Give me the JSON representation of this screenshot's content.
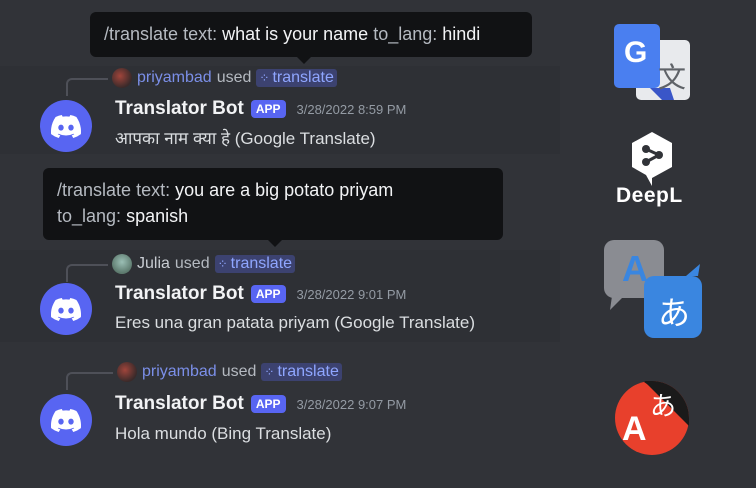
{
  "messages": [
    {
      "invoker": "priyambad",
      "used": "used",
      "command": "translate",
      "bot_name": "Translator Bot",
      "badge": "APP",
      "timestamp": "3/28/2022 8:59 PM",
      "text": "आपका नाम क्या हे (Google Translate)"
    },
    {
      "invoker": "Julia",
      "used": "used",
      "command": "translate",
      "bot_name": "Translator Bot",
      "badge": "APP",
      "timestamp": "3/28/2022 9:01 PM",
      "text": "Eres una gran patata priyam (Google Translate)"
    },
    {
      "invoker": "priyambad",
      "used": "used",
      "command": "translate",
      "bot_name": "Translator Bot",
      "badge": "APP",
      "timestamp": "3/28/2022 9:07 PM",
      "text": "Hola mundo (Bing Translate)"
    }
  ],
  "tooltips": [
    {
      "cmd": "/translate",
      "k1": "text:",
      "v1": "what is your name",
      "k2": "to_lang:",
      "v2": "hindi"
    },
    {
      "cmd": "/translate",
      "k1": "text:",
      "v1": "you are a big potato priyam",
      "k2": "to_lang:",
      "v2": "spanish"
    }
  ],
  "logos": {
    "deepl_label": "DeepL",
    "google_glyph_g": "G",
    "google_glyph_wen": "文",
    "translate_glyph_a": "A",
    "translate_glyph_a_hira": "あ",
    "bing_glyph_a": "A",
    "bing_glyph_a_hira": "あ"
  },
  "colors": {
    "background": "#313338",
    "blurple": "#5865f2",
    "tooltip": "#111214",
    "command_pill": "#3c4270"
  }
}
